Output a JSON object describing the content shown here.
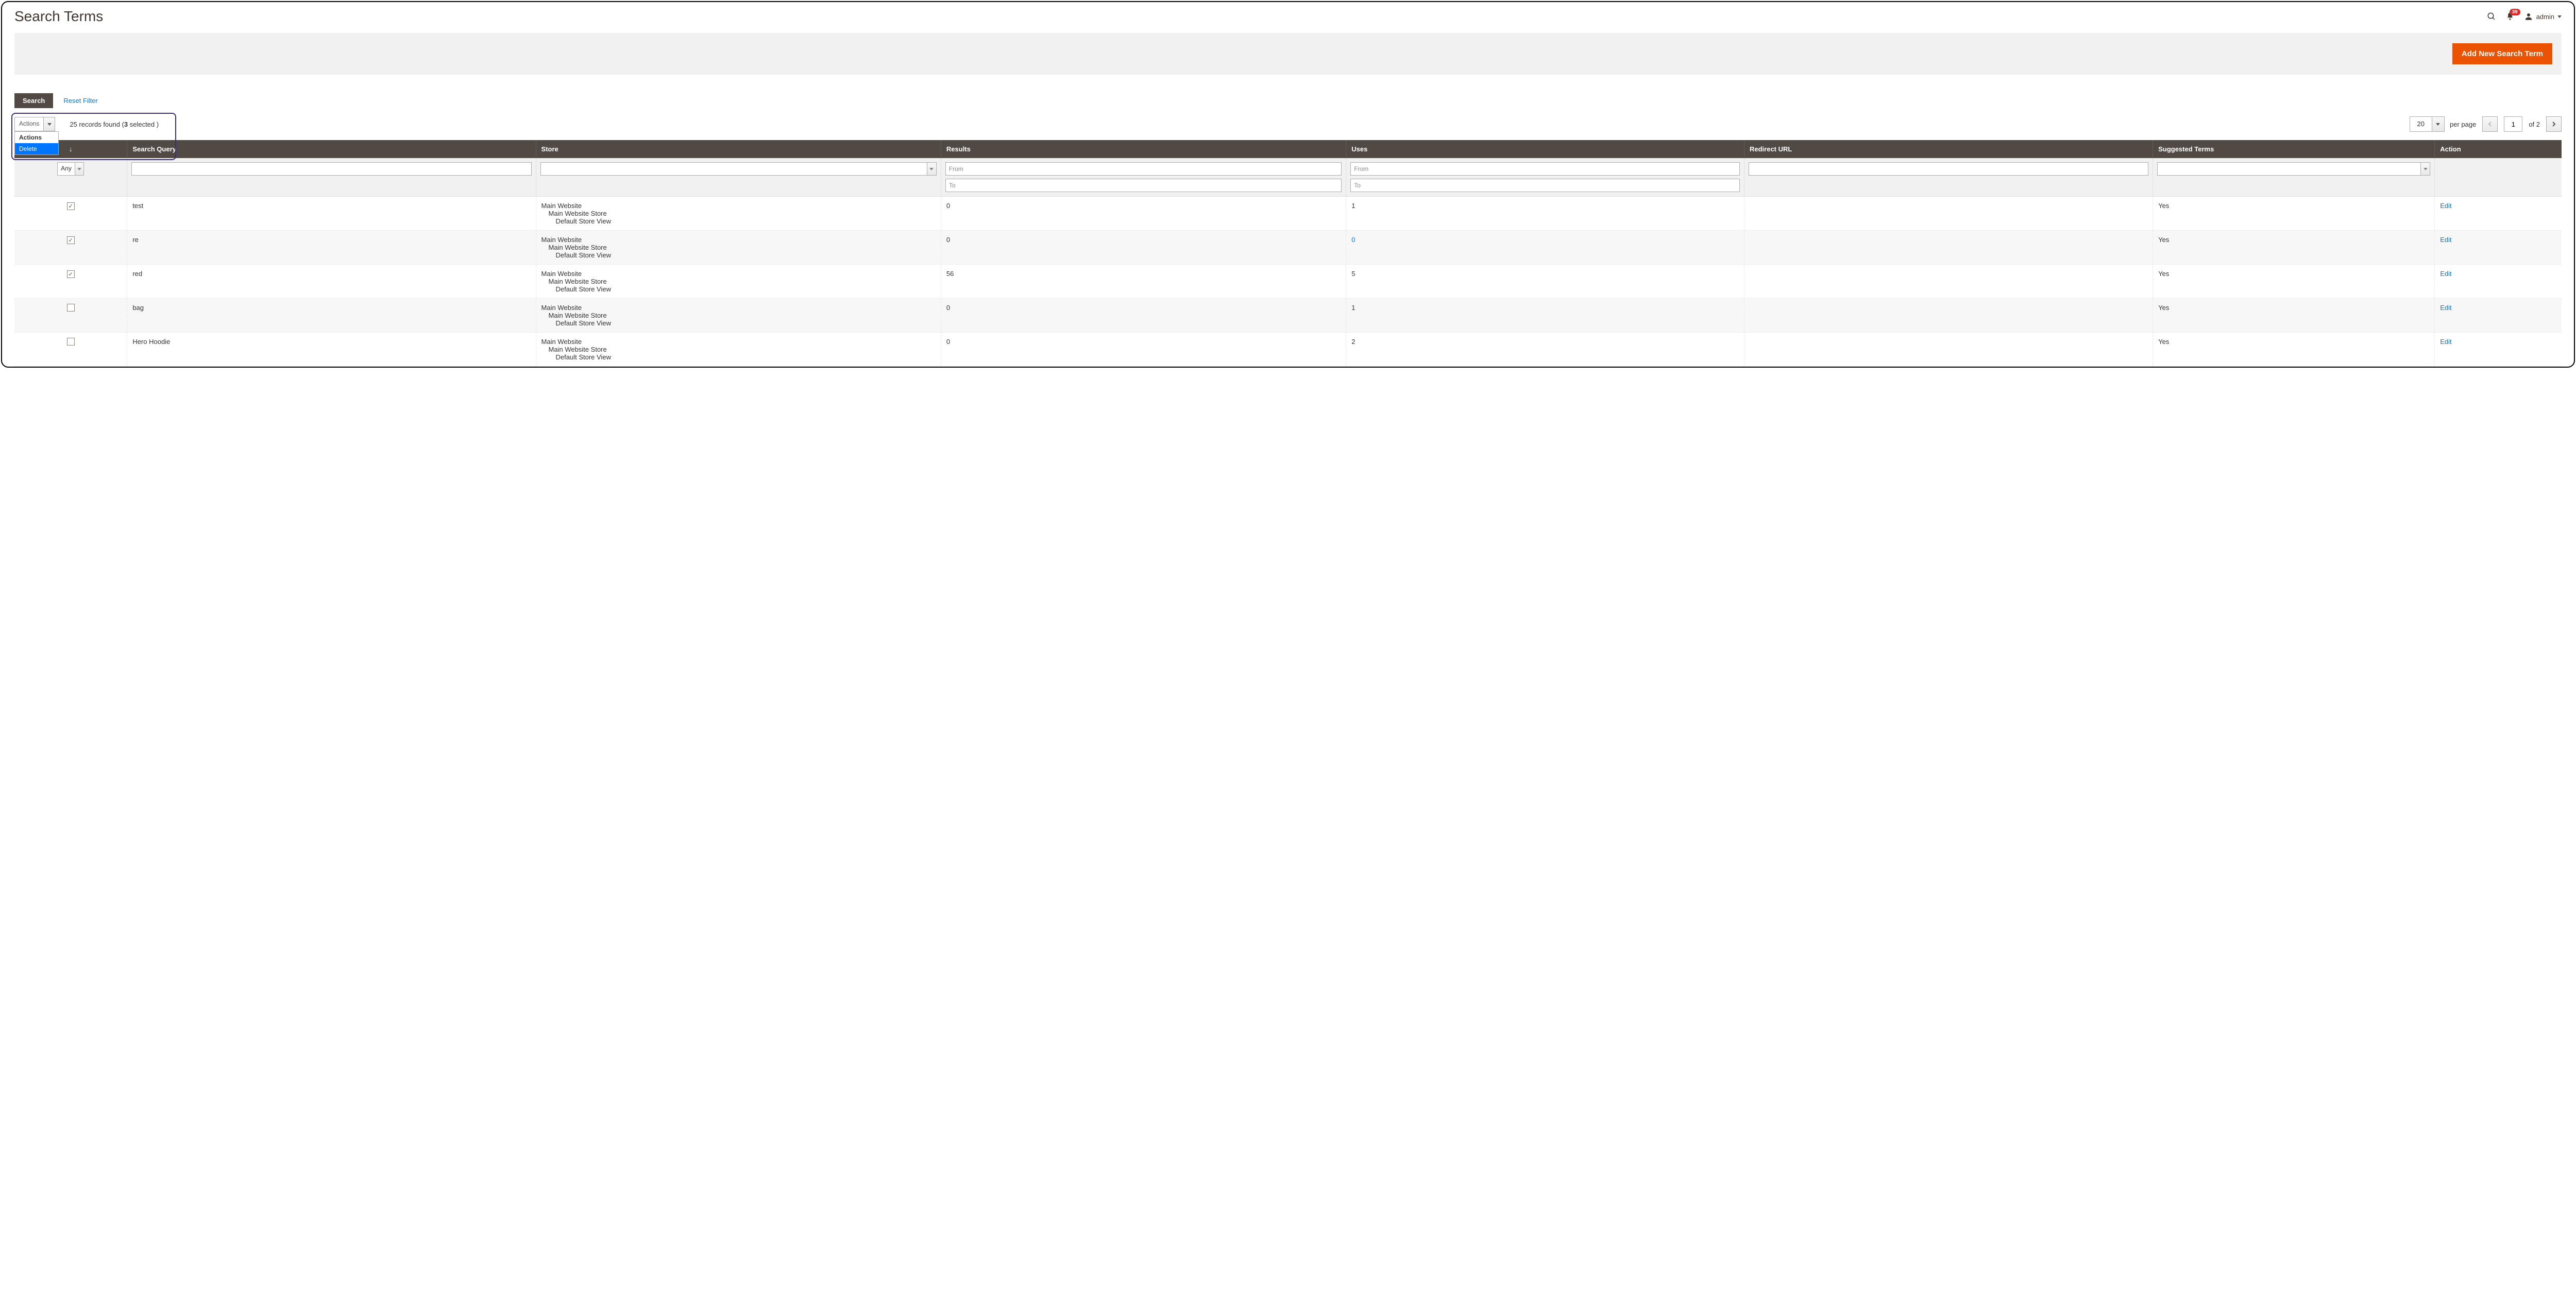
{
  "header": {
    "title": "Search Terms",
    "notifications_count": "39",
    "admin_label": "admin"
  },
  "buttons": {
    "add_new": "Add New Search Term"
  },
  "filter_bar": {
    "search_tab": "Search",
    "reset_filter": "Reset Filter"
  },
  "actions": {
    "trigger_label": "Actions",
    "menu_header": "Actions",
    "menu_delete": "Delete"
  },
  "records": {
    "prefix": "25 records found (",
    "selected": "3",
    "suffix": " selected )"
  },
  "pagination": {
    "per_page_value": "20",
    "per_page_label": "per page",
    "page_value": "1",
    "of_label": "of 2"
  },
  "columns": {
    "search_query": "Search Query",
    "store": "Store",
    "results": "Results",
    "uses": "Uses",
    "redirect_url": "Redirect URL",
    "suggested_terms": "Suggested Terms",
    "action": "Action"
  },
  "filters": {
    "any_label": "Any",
    "from_placeholder": "From",
    "to_placeholder": "To"
  },
  "store_tree": {
    "l1": "Main Website",
    "l2": "Main Website Store",
    "l3": "Default Store View"
  },
  "action_edit": "Edit",
  "rows": [
    {
      "checked": true,
      "query": "test",
      "results": "0",
      "uses": "1",
      "uses_link": false,
      "redirect": "",
      "suggested": "Yes",
      "alt": false
    },
    {
      "checked": true,
      "query": "re",
      "results": "0",
      "uses": "0",
      "uses_link": true,
      "redirect": "",
      "suggested": "Yes",
      "alt": true
    },
    {
      "checked": true,
      "query": "red",
      "results": "56",
      "uses": "5",
      "uses_link": false,
      "redirect": "",
      "suggested": "Yes",
      "alt": false
    },
    {
      "checked": false,
      "query": "bag",
      "results": "0",
      "uses": "1",
      "uses_link": false,
      "redirect": "",
      "suggested": "Yes",
      "alt": true
    },
    {
      "checked": false,
      "query": "Hero Hoodie",
      "results": "0",
      "uses": "2",
      "uses_link": false,
      "redirect": "",
      "suggested": "Yes",
      "alt": false
    }
  ]
}
